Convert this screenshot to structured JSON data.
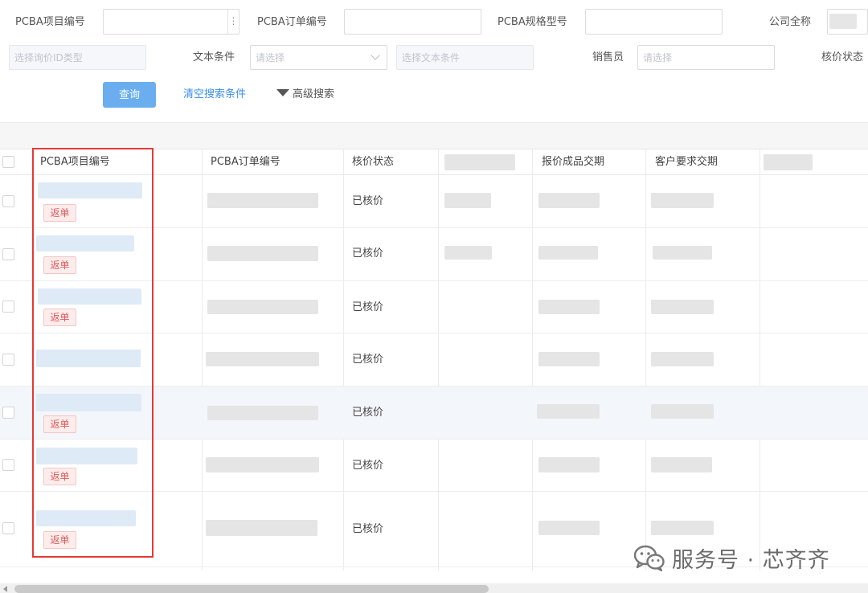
{
  "filters": {
    "pcba_project_label": "PCBA项目编号",
    "pcba_order_label": "PCBA订单编号",
    "pcba_spec_label": "PCBA规格型号",
    "company_label": "公司全称",
    "inquiry_id_type_placeholder": "选择询价ID类型",
    "text_condition_label": "文本条件",
    "text_condition_select_placeholder": "请选择",
    "text_condition_input_placeholder": "选择文本条件",
    "salesperson_label": "销售员",
    "salesperson_placeholder": "请选择",
    "pricing_status_label": "核价状态"
  },
  "actions": {
    "query_label": "查询",
    "clear_label": "清空搜索条件",
    "advanced_label": "高级搜索"
  },
  "table": {
    "headers": {
      "project_no": "PCBA项目编号",
      "order_no": "PCBA订单编号",
      "pricing_status": "核价状态",
      "quote_delivery": "报价成品交期",
      "customer_delivery": "客户要求交期"
    },
    "rows": [
      {
        "status": "已核价",
        "tag": "返单"
      },
      {
        "status": "已核价",
        "tag": "返单"
      },
      {
        "status": "已核价",
        "tag": "返单"
      },
      {
        "status": "已核价",
        "tag": ""
      },
      {
        "status": "已核价",
        "tag": "返单"
      },
      {
        "status": "已核价",
        "tag": "返单"
      },
      {
        "status": "已核价",
        "tag": "返单"
      }
    ]
  },
  "watermark": {
    "text": "服务号 · 芯齐齐",
    "icon": "wechat-icon"
  },
  "colors": {
    "primary_button": "#6aaef0",
    "link": "#3a8ee6",
    "tag_text": "#e05a5a",
    "highlight_border": "#e53935"
  }
}
